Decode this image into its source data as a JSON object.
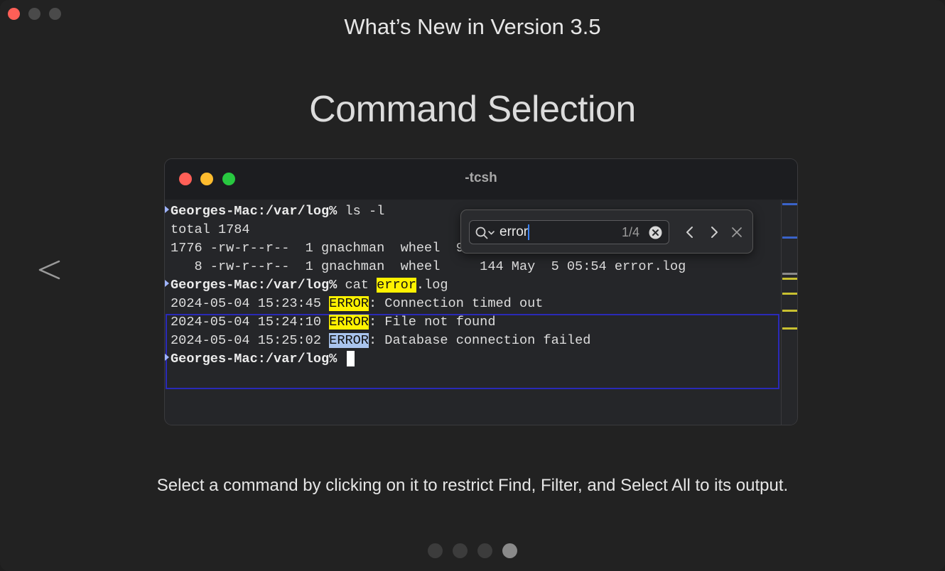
{
  "window": {
    "title": "What’s New in Version 3.5",
    "traffic_lights": [
      "close",
      "minimize",
      "zoom"
    ]
  },
  "feature": {
    "title": "Command Selection",
    "description": "Select a command by clicking on it to restrict Find, Filter, and Select All to its output."
  },
  "navigation": {
    "prev_icon": "chevron-left-icon",
    "page_count": 4,
    "current_page": 4
  },
  "terminal": {
    "title": "-tcsh",
    "prompt": "Georges-Mac:/var/log%",
    "cmd1": " ls -l",
    "total": "total 1784",
    "row1": "1776 -rw-r--r--  1 gnachman  wheel  907",
    "row2": "   8 -rw-r--r--  1 gnachman  wheel     144 May  5 05:54 error.log",
    "cmd2_prefix": " cat ",
    "cmd2_match": "error",
    "cmd2_suffix": ".log",
    "log_lines": [
      {
        "timestamp": "2024-05-04 15:23:45 ",
        "level": "ERROR",
        "message": ": Connection timed out"
      },
      {
        "timestamp": "2024-05-04 15:24:10 ",
        "level": "ERROR",
        "message": ": File not found"
      },
      {
        "timestamp": "2024-05-04 15:25:02 ",
        "level": "ERROR",
        "message": ": Database connection failed"
      }
    ],
    "colors": {
      "match_highlight": "#fff200",
      "current_match": "#a9c4ee",
      "selection_border": "#2a2ab8"
    }
  },
  "find": {
    "query": "error",
    "count": "1/4",
    "icons": [
      "search-options-icon",
      "clear-icon",
      "previous-icon",
      "next-icon",
      "close-icon"
    ]
  }
}
